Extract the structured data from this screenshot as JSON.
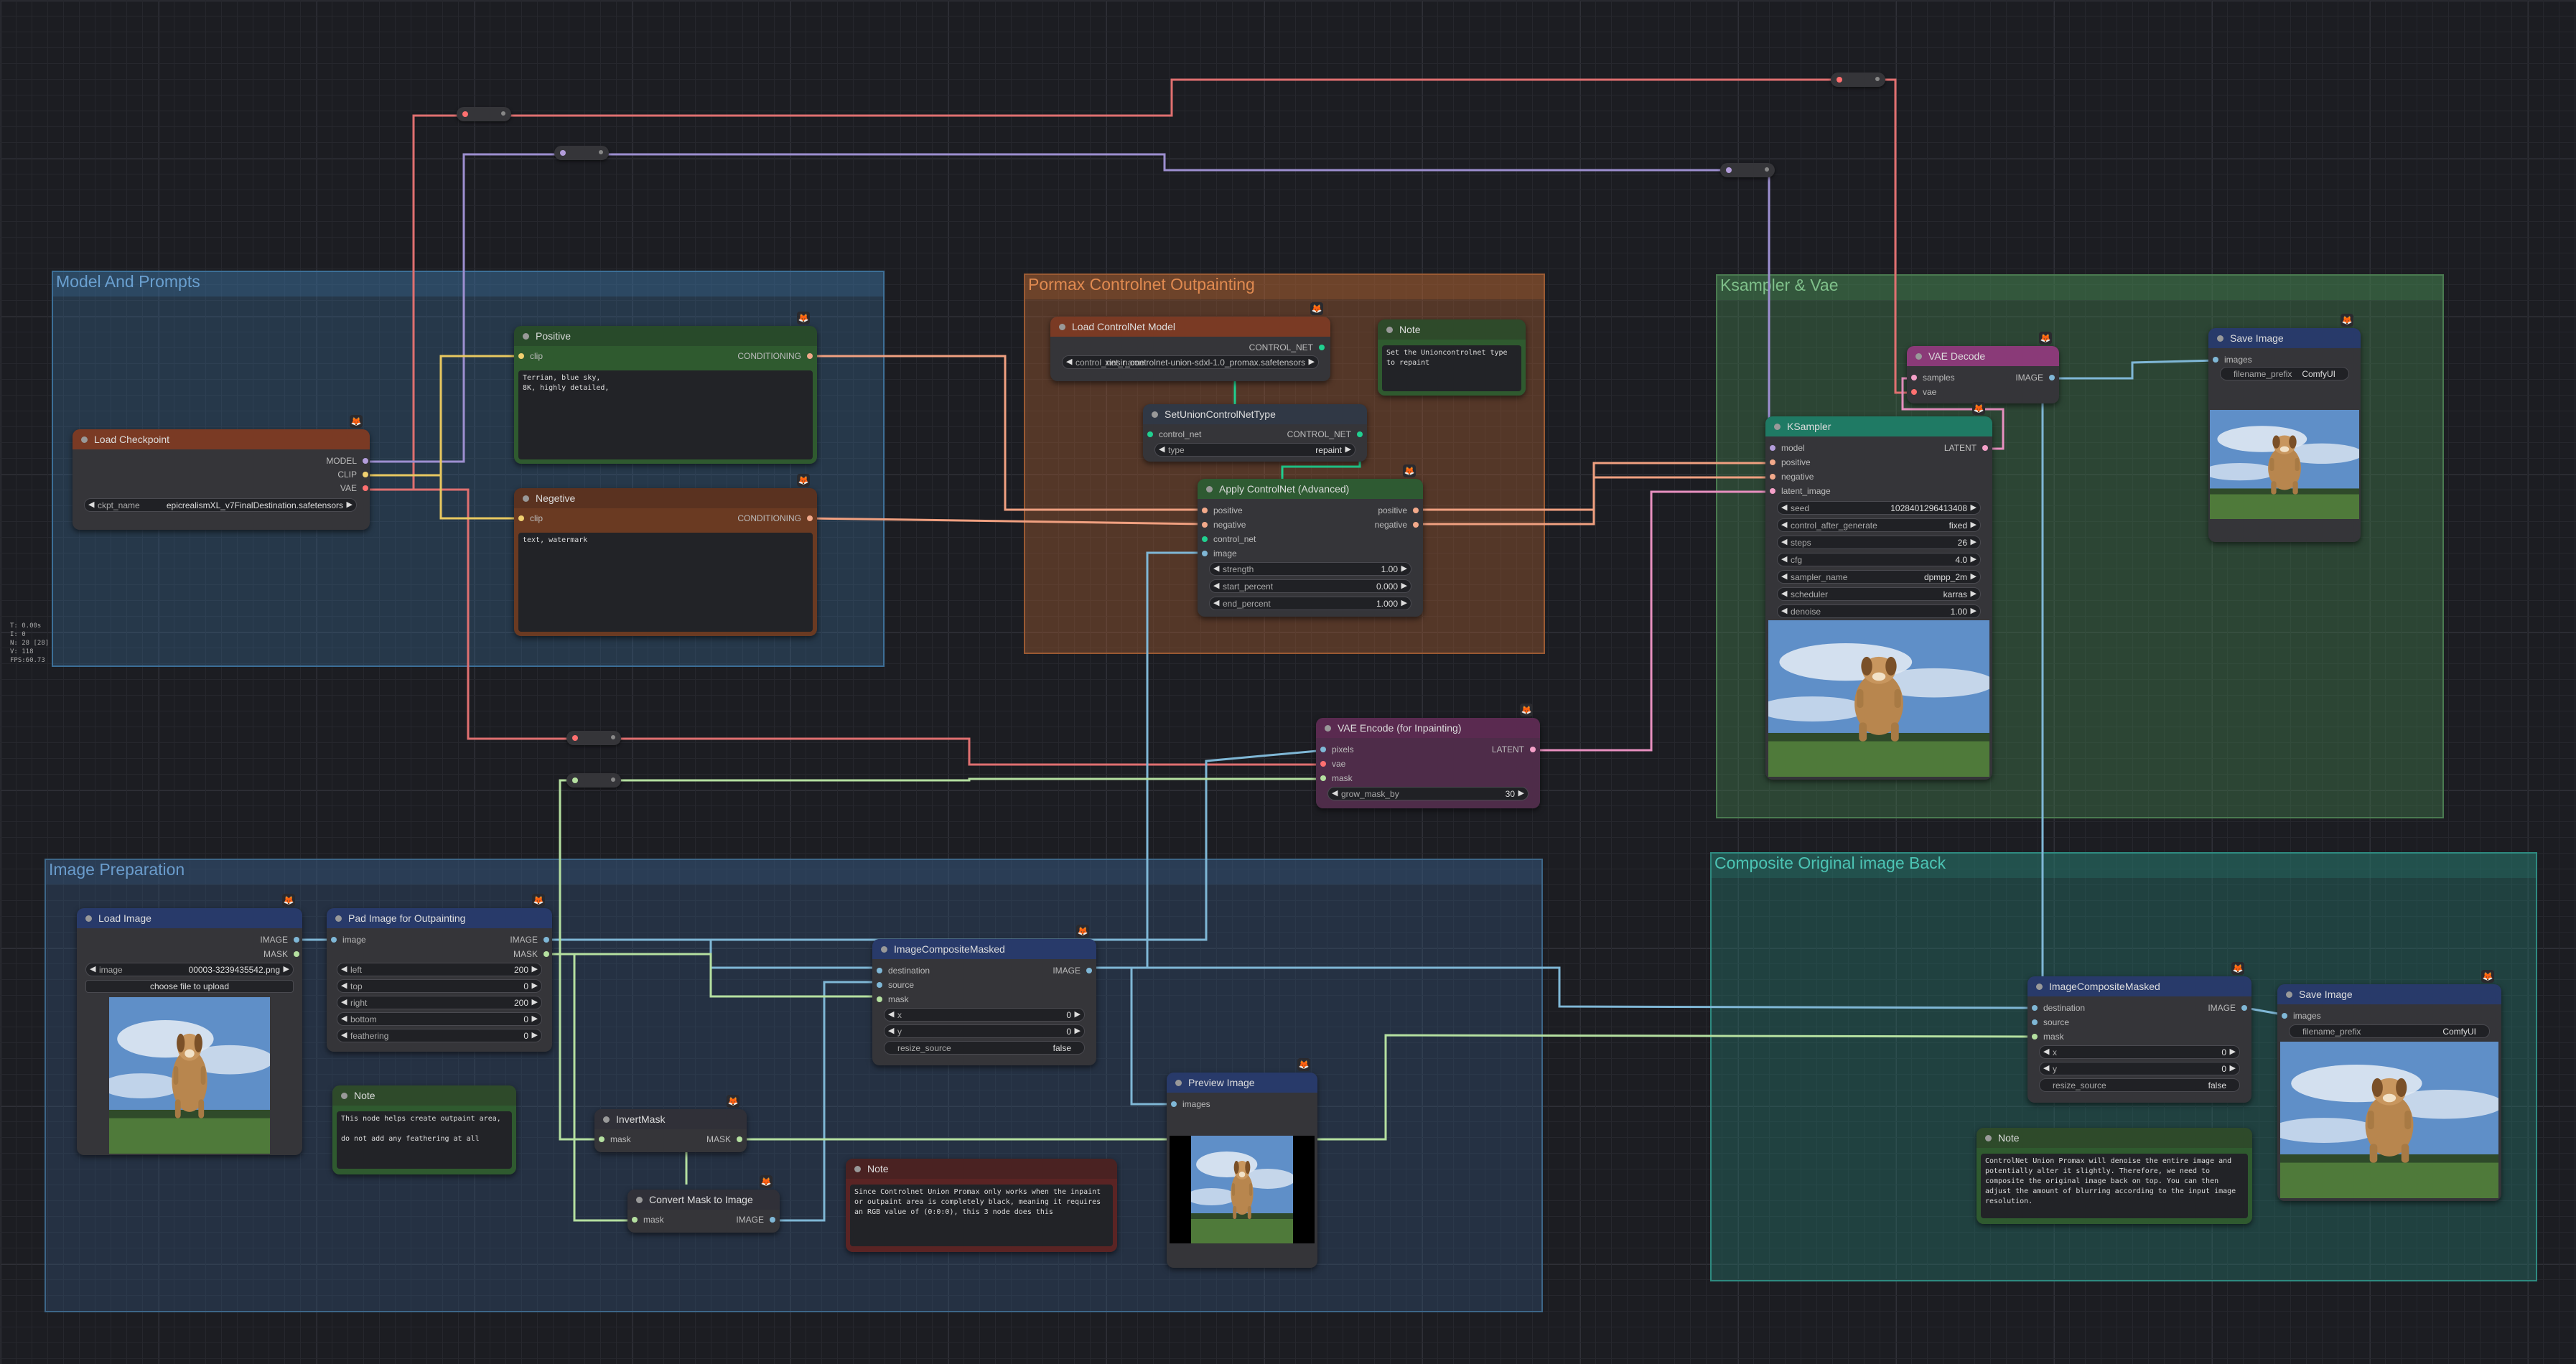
{
  "stats": [
    "T: 0.00s",
    "I: 0",
    "N: 28 [28]",
    "V: 118",
    "FPS:60.73"
  ],
  "groups": {
    "model": "Model And Prompts",
    "controlnet": "Pormax Controlnet Outpainting",
    "ksampler": "Ksampler & Vae",
    "imageprep": "Image Preparation",
    "composite": "Composite Original image Back"
  },
  "nodes": {
    "load_checkpoint": {
      "title": "Load Checkpoint",
      "outputs": [
        "MODEL",
        "CLIP",
        "VAE"
      ],
      "widget_label": "ckpt_name",
      "widget_value": "epicrealismXL_v7FinalDestination.safetensors"
    },
    "positive": {
      "title": "Positive",
      "input": "clip",
      "output": "CONDITIONING",
      "text": "Terrian, blue sky,\n8K, highly detailed,"
    },
    "negative": {
      "title": "Negetive",
      "input": "clip",
      "output": "CONDITIONING",
      "text": "text, watermark"
    },
    "load_controlnet": {
      "title": "Load ControlNet Model",
      "output": "CONTROL_NET",
      "widget_label": "control_net_name",
      "widget_value": "diffusion_pytorch_model_promax.safetensors",
      "widget_overlap": "xinsir_controlnet-union-sdxl-1.0_promax.safetensors"
    },
    "note_union": {
      "title": "Note",
      "text": "Set the Unioncontrolnet type to repaint"
    },
    "set_union": {
      "title": "SetUnionControlNetType",
      "input": "control_net",
      "output": "CONTROL_NET",
      "widget_label": "type",
      "widget_value": "repaint"
    },
    "apply_controlnet": {
      "title": "Apply ControlNet (Advanced)",
      "inputs": [
        "positive",
        "negative",
        "control_net",
        "image"
      ],
      "outputs": [
        "positive",
        "negative"
      ],
      "widgets": [
        {
          "label": "strength",
          "value": "1.00"
        },
        {
          "label": "start_percent",
          "value": "0.000"
        },
        {
          "label": "end_percent",
          "value": "1.000"
        }
      ]
    },
    "vae_decode": {
      "title": "VAE Decode",
      "inputs": [
        "samples",
        "vae"
      ],
      "output": "IMAGE"
    },
    "save_image_1": {
      "title": "Save Image",
      "input": "images",
      "widget_label": "filename_prefix",
      "widget_value": "ComfyUI"
    },
    "ksampler": {
      "title": "KSampler",
      "inputs": [
        "model",
        "positive",
        "negative",
        "latent_image"
      ],
      "output": "LATENT",
      "widgets": [
        {
          "label": "seed",
          "value": "1028401296413408"
        },
        {
          "label": "control_after_generate",
          "value": "fixed"
        },
        {
          "label": "steps",
          "value": "26"
        },
        {
          "label": "cfg",
          "value": "4.0"
        },
        {
          "label": "sampler_name",
          "value": "dpmpp_2m"
        },
        {
          "label": "scheduler",
          "value": "karras"
        },
        {
          "label": "denoise",
          "value": "1.00"
        }
      ]
    },
    "vae_encode": {
      "title": "VAE Encode (for Inpainting)",
      "inputs": [
        "pixels",
        "vae",
        "mask"
      ],
      "output": "LATENT",
      "widget_label": "grow_mask_by",
      "widget_value": "30"
    },
    "load_image": {
      "title": "Load Image",
      "outputs": [
        "IMAGE",
        "MASK"
      ],
      "widget_label": "image",
      "widget_value": "00003-3239435542.png",
      "button": "choose file to upload"
    },
    "pad_image": {
      "title": "Pad Image for Outpainting",
      "input": "image",
      "outputs": [
        "IMAGE",
        "MASK"
      ],
      "widgets": [
        {
          "label": "left",
          "value": "200"
        },
        {
          "label": "top",
          "value": "0"
        },
        {
          "label": "right",
          "value": "200"
        },
        {
          "label": "bottom",
          "value": "0"
        },
        {
          "label": "feathering",
          "value": "0"
        }
      ]
    },
    "note_pad": {
      "title": "Note",
      "text": "This node helps create outpaint area,\n\ndo not add any feathering at all"
    },
    "invert_mask": {
      "title": "InvertMask",
      "input": "mask",
      "output": "MASK"
    },
    "convert_mask": {
      "title": "Convert Mask to Image",
      "input": "mask",
      "output": "IMAGE"
    },
    "image_composite_1": {
      "title": "ImageCompositeMasked",
      "inputs": [
        "destination",
        "source",
        "mask"
      ],
      "output": "IMAGE",
      "widgets": [
        {
          "label": "x",
          "value": "0"
        },
        {
          "label": "y",
          "value": "0"
        },
        {
          "label": "resize_source",
          "value": "false"
        }
      ]
    },
    "note_composite": {
      "title": "Note",
      "text": "Since Controlnet Union Promax only works when the inpaint or outpaint area is completely black, meaning it requires an RGB value of (0:0:0), this 3 node does this"
    },
    "preview_image": {
      "title": "Preview Image",
      "input": "images"
    },
    "image_composite_2": {
      "title": "ImageCompositeMasked",
      "inputs": [
        "destination",
        "source",
        "mask"
      ],
      "output": "IMAGE",
      "widgets": [
        {
          "label": "x",
          "value": "0"
        },
        {
          "label": "y",
          "value": "0"
        },
        {
          "label": "resize_source",
          "value": "false"
        }
      ]
    },
    "save_image_2": {
      "title": "Save Image",
      "input": "images",
      "widget_label": "filename_prefix",
      "widget_value": "ComfyUI"
    },
    "note_final": {
      "title": "Note",
      "text": "ControlNet Union Promax will denoise the entire image and potentially alter it slightly. Therefore, we need to composite the original image back on top. You can then adjust the amount of blurring according to the input image resolution."
    }
  },
  "colors": {
    "clip": "#f0d070",
    "model": "#b39ddb",
    "vae": "#ff7070",
    "conditioning": "#f2a98a",
    "image": "#7fb7d6",
    "mask": "#b5e0a0",
    "latent": "#f4a0c8",
    "control_net": "#20d090"
  },
  "icons": {
    "node_badge": "fox-icon",
    "arrow_left": "◀",
    "arrow_right": "▶"
  }
}
